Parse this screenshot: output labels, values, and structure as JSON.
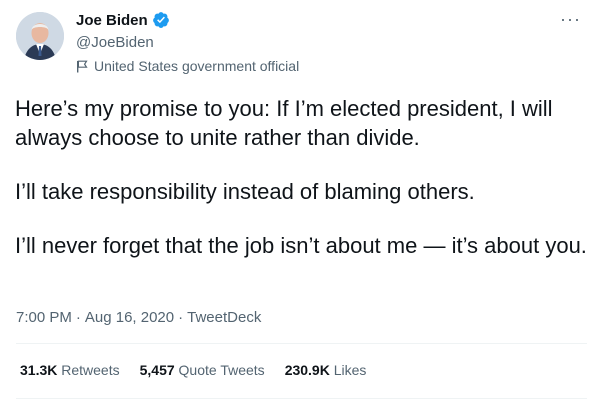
{
  "author": {
    "name": "Joe Biden",
    "handle": "@JoeBiden",
    "label": "United States government official"
  },
  "tweet": {
    "paragraphs": [
      "Here’s my promise to you: If I’m elected president, I will always choose to unite rather than divide.",
      "I’ll take responsibility instead of blaming others.",
      "I’ll never forget that the job isn’t about me — it’s about you."
    ],
    "time": "7:00 PM",
    "date": "Aug 16, 2020",
    "source": "TweetDeck",
    "separator": "·"
  },
  "stats": {
    "retweets_count": "31.3K",
    "retweets_label": "Retweets",
    "quotes_count": "5,457",
    "quotes_label": "Quote Tweets",
    "likes_count": "230.9K",
    "likes_label": "Likes"
  },
  "icons": {
    "verified": "verified-badge-icon",
    "label_flag": "flag-icon",
    "more": "more-icon"
  },
  "colors": {
    "verified_blue": "#1d9bf0",
    "secondary_text": "#536471",
    "primary_text": "#0f1419"
  }
}
